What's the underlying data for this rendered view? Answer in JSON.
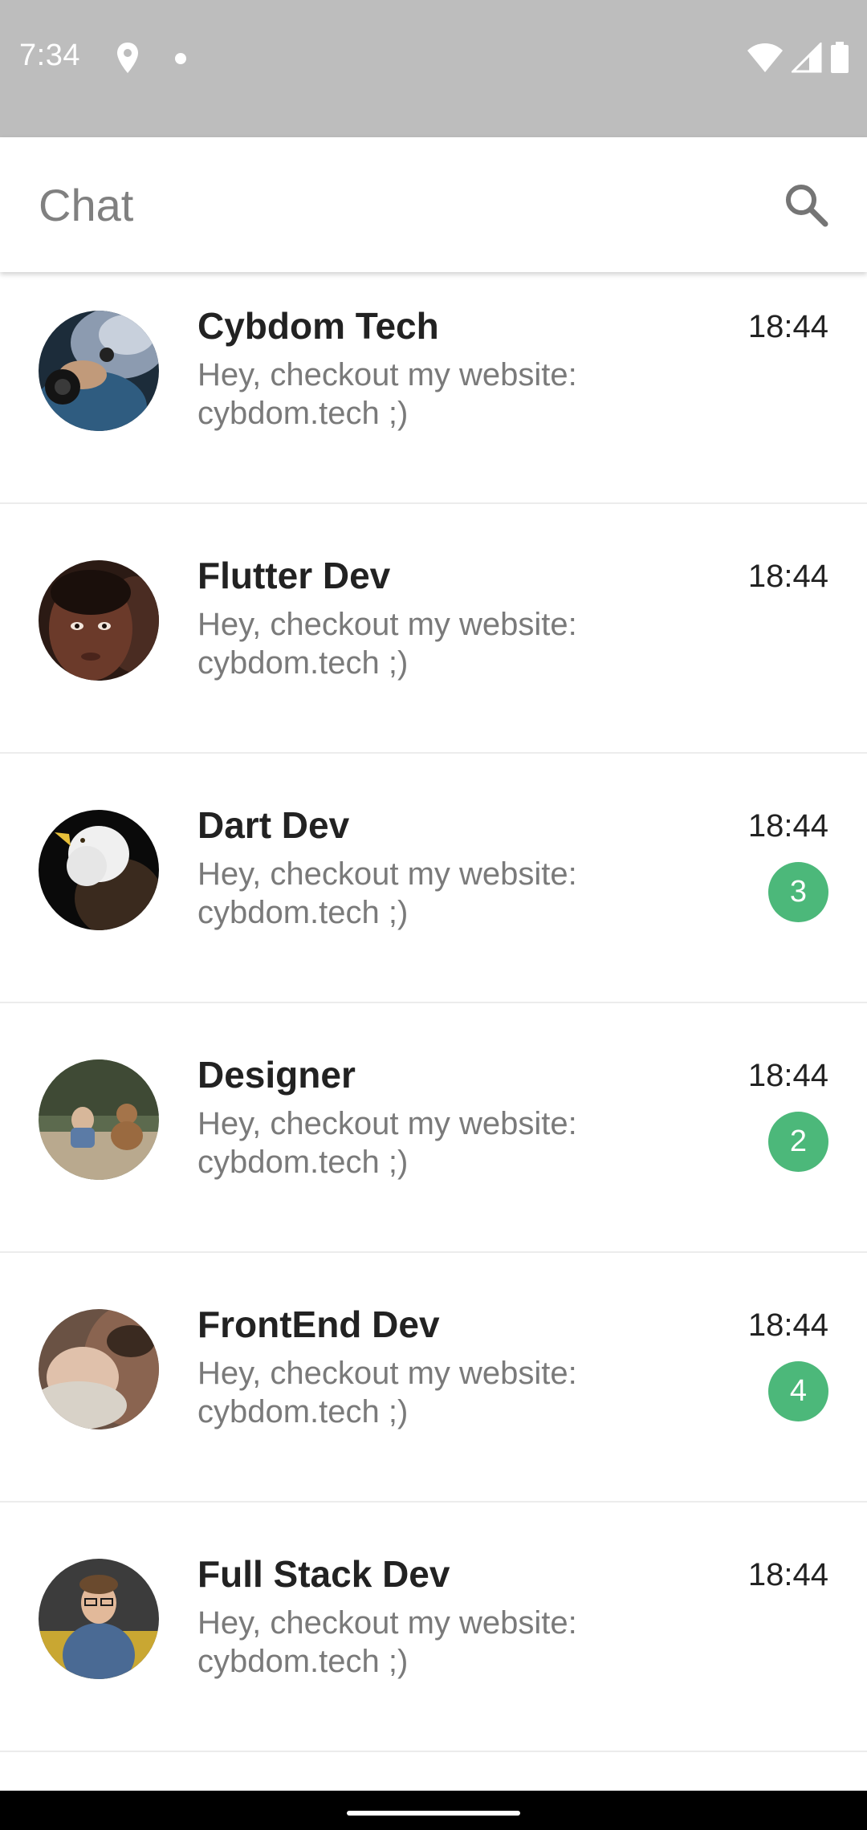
{
  "status_bar": {
    "time": "7:34",
    "icons": [
      "location-icon",
      "notification-dot-icon",
      "wifi-icon",
      "signal-icon",
      "battery-icon"
    ]
  },
  "app_bar": {
    "title": "Chat",
    "search_icon": "search-icon"
  },
  "colors": {
    "status_bar_bg": "#bdbdbd",
    "badge_green": "#4cb87a",
    "title_gray": "#808080"
  },
  "chats": [
    {
      "name": "Cybdom Tech",
      "message": "Hey, checkout my website: cybdom.tech ;)",
      "time": "18:44",
      "unread": null
    },
    {
      "name": "Flutter Dev",
      "message": "Hey, checkout my website: cybdom.tech ;)",
      "time": "18:44",
      "unread": null
    },
    {
      "name": "Dart Dev",
      "message": "Hey, checkout my website: cybdom.tech ;)",
      "time": "18:44",
      "unread": "3"
    },
    {
      "name": "Designer",
      "message": "Hey, checkout my website: cybdom.tech ;)",
      "time": "18:44",
      "unread": "2"
    },
    {
      "name": "FrontEnd Dev",
      "message": "Hey, checkout my website: cybdom.tech ;)",
      "time": "18:44",
      "unread": "4"
    },
    {
      "name": "Full Stack Dev",
      "message": "Hey, checkout my website: cybdom.tech ;)",
      "time": "18:44",
      "unread": null
    }
  ]
}
